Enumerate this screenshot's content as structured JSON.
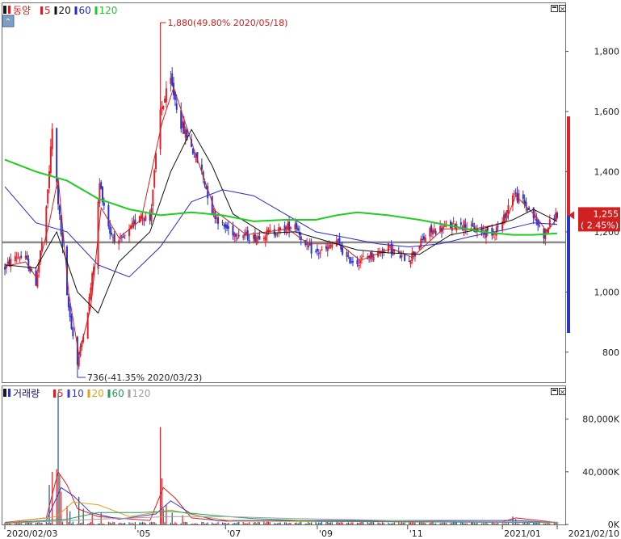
{
  "colors": {
    "up": "#e0202a",
    "down": "#2b34c8",
    "ma5": "#d42020",
    "ma20": "#111111",
    "ma60": "#2a2acc",
    "ma120": "#22cc22",
    "support": "#8a8a8a",
    "vol5": "#e02020",
    "vol10": "#3a3ad8",
    "vol20": "#e0a020",
    "vol60": "#2a9a5a",
    "vol120": "#a0a0a0"
  },
  "price_legend": {
    "name": "동양",
    "items": [
      {
        "label": "5",
        "color": "#d42020"
      },
      {
        "label": "20",
        "color": "#111111"
      },
      {
        "label": "60",
        "color": "#2a2acc"
      },
      {
        "label": "120",
        "color": "#22cc22"
      }
    ]
  },
  "volume_legend": {
    "name": "거래량",
    "items": [
      {
        "label": "5",
        "color": "#e02020"
      },
      {
        "label": "10",
        "color": "#3a3ad8"
      },
      {
        "label": "20",
        "color": "#e0a020"
      },
      {
        "label": "60",
        "color": "#2a9a5a"
      },
      {
        "label": "120",
        "color": "#a0a0a0"
      }
    ]
  },
  "annotations": {
    "high": "1,880(49.80% 2020/05/18)",
    "low": "736(-41.35% 2020/03/23)",
    "last_price": "1,255",
    "last_change": "( 2.45%)"
  },
  "chart_data": [
    {
      "type": "candlestick",
      "title": "동양",
      "ylim": [
        700,
        1960
      ],
      "y_ticks": [
        {
          "value": 800,
          "label": "800"
        },
        {
          "value": 1000,
          "label": "1,000"
        },
        {
          "value": 1200,
          "label": "1,200"
        },
        {
          "value": 1400,
          "label": "1,400"
        },
        {
          "value": 1600,
          "label": "1,600"
        },
        {
          "value": 1800,
          "label": "1,800"
        }
      ],
      "x_ticks": [
        {
          "date": "2020-02-03",
          "label": "2020/02/03"
        },
        {
          "date": "2020-05-01",
          "label": "'05"
        },
        {
          "date": "2020-07-01",
          "label": "'07"
        },
        {
          "date": "2020-09-01",
          "label": "'09"
        },
        {
          "date": "2020-11-01",
          "label": "'11"
        },
        {
          "date": "2021-01-04",
          "label": "2021/01"
        },
        {
          "date": "2021-02-10",
          "label": "2021/02/10"
        }
      ],
      "x_range": [
        "2020-02-03",
        "2021-02-10"
      ],
      "support_level": 1165,
      "high": {
        "value": 1880,
        "date": "2020-05-18"
      },
      "low": {
        "value": 736,
        "date": "2020-03-23"
      },
      "last": {
        "value": 1255,
        "change_pct": 2.45
      },
      "price_path": [
        [
          "2020-02-03",
          1080
        ],
        [
          "2020-02-10",
          1120
        ],
        [
          "2020-02-17",
          1110
        ],
        [
          "2020-02-24",
          1030
        ],
        [
          "2020-03-02",
          1270
        ],
        [
          "2020-03-06",
          1540
        ],
        [
          "2020-03-10",
          1300
        ],
        [
          "2020-03-16",
          980
        ],
        [
          "2020-03-23",
          760
        ],
        [
          "2020-03-30",
          940
        ],
        [
          "2020-04-03",
          1090
        ],
        [
          "2020-04-07",
          1360
        ],
        [
          "2020-04-14",
          1200
        ],
        [
          "2020-04-20",
          1160
        ],
        [
          "2020-04-27",
          1200
        ],
        [
          "2020-05-04",
          1260
        ],
        [
          "2020-05-11",
          1240
        ],
        [
          "2020-05-18",
          1600
        ],
        [
          "2020-05-25",
          1700
        ],
        [
          "2020-06-01",
          1560
        ],
        [
          "2020-06-08",
          1480
        ],
        [
          "2020-06-15",
          1400
        ],
        [
          "2020-06-22",
          1270
        ],
        [
          "2020-06-29",
          1220
        ],
        [
          "2020-07-06",
          1200
        ],
        [
          "2020-07-13",
          1190
        ],
        [
          "2020-07-20",
          1180
        ],
        [
          "2020-07-27",
          1195
        ],
        [
          "2020-08-03",
          1200
        ],
        [
          "2020-08-10",
          1210
        ],
        [
          "2020-08-17",
          1230
        ],
        [
          "2020-08-24",
          1150
        ],
        [
          "2020-08-31",
          1130
        ],
        [
          "2020-09-07",
          1140
        ],
        [
          "2020-09-14",
          1170
        ],
        [
          "2020-09-21",
          1110
        ],
        [
          "2020-09-28",
          1100
        ],
        [
          "2020-10-05",
          1120
        ],
        [
          "2020-10-12",
          1130
        ],
        [
          "2020-10-19",
          1150
        ],
        [
          "2020-10-26",
          1120
        ],
        [
          "2020-11-02",
          1110
        ],
        [
          "2020-11-09",
          1160
        ],
        [
          "2020-11-16",
          1200
        ],
        [
          "2020-11-23",
          1210
        ],
        [
          "2020-11-30",
          1220
        ],
        [
          "2020-12-07",
          1230
        ],
        [
          "2020-12-14",
          1210
        ],
        [
          "2020-12-21",
          1200
        ],
        [
          "2020-12-28",
          1200
        ],
        [
          "2021-01-04",
          1230
        ],
        [
          "2021-01-11",
          1330
        ],
        [
          "2021-01-18",
          1300
        ],
        [
          "2021-01-25",
          1250
        ],
        [
          "2021-02-01",
          1190
        ],
        [
          "2021-02-08",
          1255
        ]
      ],
      "series": [
        {
          "name": "5",
          "values": [
            [
              "2020-02-03",
              1085
            ],
            [
              "2020-02-17",
              1100
            ],
            [
              "2020-02-24",
              1050
            ],
            [
              "2020-03-04",
              1230
            ],
            [
              "2020-03-10",
              1380
            ],
            [
              "2020-03-17",
              1000
            ],
            [
              "2020-03-24",
              790
            ],
            [
              "2020-04-01",
              950
            ],
            [
              "2020-04-08",
              1280
            ],
            [
              "2020-04-20",
              1180
            ],
            [
              "2020-05-05",
              1240
            ],
            [
              "2020-05-19",
              1560
            ],
            [
              "2020-05-27",
              1680
            ],
            [
              "2020-06-10",
              1470
            ],
            [
              "2020-06-24",
              1270
            ],
            [
              "2020-07-15",
              1190
            ],
            [
              "2020-08-12",
              1210
            ],
            [
              "2020-08-26",
              1160
            ],
            [
              "2020-09-16",
              1160
            ],
            [
              "2020-09-30",
              1105
            ],
            [
              "2020-10-21",
              1145
            ],
            [
              "2020-11-04",
              1115
            ],
            [
              "2020-11-25",
              1210
            ],
            [
              "2020-12-16",
              1210
            ],
            [
              "2021-01-06",
              1230
            ],
            [
              "2021-01-13",
              1320
            ],
            [
              "2021-01-27",
              1250
            ],
            [
              "2021-02-03",
              1200
            ],
            [
              "2021-02-10",
              1245
            ]
          ]
        },
        {
          "name": "20",
          "values": [
            [
              "2020-02-03",
              1090
            ],
            [
              "2020-02-24",
              1080
            ],
            [
              "2020-03-09",
              1200
            ],
            [
              "2020-03-23",
              1000
            ],
            [
              "2020-04-06",
              930
            ],
            [
              "2020-04-20",
              1100
            ],
            [
              "2020-05-11",
              1200
            ],
            [
              "2020-05-25",
              1400
            ],
            [
              "2020-06-08",
              1540
            ],
            [
              "2020-06-22",
              1420
            ],
            [
              "2020-07-06",
              1260
            ],
            [
              "2020-07-27",
              1195
            ],
            [
              "2020-08-17",
              1200
            ],
            [
              "2020-09-07",
              1170
            ],
            [
              "2020-09-28",
              1140
            ],
            [
              "2020-10-19",
              1130
            ],
            [
              "2020-11-09",
              1125
            ],
            [
              "2020-11-30",
              1190
            ],
            [
              "2020-12-21",
              1210
            ],
            [
              "2021-01-11",
              1240
            ],
            [
              "2021-01-25",
              1275
            ],
            [
              "2021-02-10",
              1235
            ]
          ]
        },
        {
          "name": "60",
          "values": [
            [
              "2020-02-03",
              1350
            ],
            [
              "2020-02-24",
              1230
            ],
            [
              "2020-03-16",
              1200
            ],
            [
              "2020-04-06",
              1090
            ],
            [
              "2020-04-27",
              1050
            ],
            [
              "2020-05-18",
              1150
            ],
            [
              "2020-06-08",
              1300
            ],
            [
              "2020-06-29",
              1340
            ],
            [
              "2020-07-20",
              1320
            ],
            [
              "2020-08-10",
              1260
            ],
            [
              "2020-08-31",
              1200
            ],
            [
              "2020-09-21",
              1180
            ],
            [
              "2020-10-12",
              1160
            ],
            [
              "2020-11-02",
              1150
            ],
            [
              "2020-11-23",
              1160
            ],
            [
              "2020-12-14",
              1185
            ],
            [
              "2021-01-04",
              1205
            ],
            [
              "2021-01-25",
              1230
            ],
            [
              "2021-02-10",
              1225
            ]
          ]
        },
        {
          "name": "120",
          "values": [
            [
              "2020-02-03",
              1440
            ],
            [
              "2020-02-24",
              1400
            ],
            [
              "2020-03-16",
              1370
            ],
            [
              "2020-04-06",
              1310
            ],
            [
              "2020-04-27",
              1275
            ],
            [
              "2020-05-18",
              1255
            ],
            [
              "2020-06-08",
              1265
            ],
            [
              "2020-06-29",
              1255
            ],
            [
              "2020-07-20",
              1235
            ],
            [
              "2020-08-10",
              1240
            ],
            [
              "2020-08-31",
              1240
            ],
            [
              "2020-09-14",
              1255
            ],
            [
              "2020-09-28",
              1265
            ],
            [
              "2020-10-19",
              1255
            ],
            [
              "2020-11-09",
              1240
            ],
            [
              "2020-11-30",
              1220
            ],
            [
              "2020-12-21",
              1200
            ],
            [
              "2021-01-11",
              1190
            ],
            [
              "2021-01-25",
              1190
            ],
            [
              "2021-02-10",
              1195
            ]
          ]
        }
      ]
    },
    {
      "type": "bar",
      "title": "거래량",
      "ylim": [
        0,
        105000
      ],
      "y_ticks": [
        {
          "value": 0,
          "label": "0K"
        },
        {
          "value": 40000,
          "label": "40,000K"
        },
        {
          "value": 80000,
          "label": "80,000K"
        }
      ],
      "spikes": [
        [
          "2020-03-04",
          30000
        ],
        [
          "2020-03-06",
          40000
        ],
        [
          "2020-03-09",
          42000
        ],
        [
          "2020-03-10",
          100000
        ],
        [
          "2020-03-11",
          38000
        ],
        [
          "2020-03-12",
          25000
        ],
        [
          "2020-03-16",
          14000
        ],
        [
          "2020-03-18",
          10000
        ],
        [
          "2020-03-24",
          21000
        ],
        [
          "2020-03-27",
          12000
        ],
        [
          "2020-04-02",
          8000
        ],
        [
          "2020-04-08",
          9000
        ],
        [
          "2020-05-18",
          74000
        ],
        [
          "2020-05-19",
          35000
        ],
        [
          "2020-05-20",
          12000
        ],
        [
          "2020-05-22",
          15000
        ],
        [
          "2020-05-26",
          9000
        ],
        [
          "2020-06-02",
          7000
        ],
        [
          "2021-01-11",
          6000
        ],
        [
          "2021-01-13",
          4000
        ]
      ],
      "series": [
        {
          "name": "5",
          "values": [
            [
              "2020-02-03",
              1500
            ],
            [
              "2020-03-02",
              5000
            ],
            [
              "2020-03-10",
              40000
            ],
            [
              "2020-03-16",
              30000
            ],
            [
              "2020-03-23",
              12000
            ],
            [
              "2020-04-06",
              6000
            ],
            [
              "2020-05-11",
              3000
            ],
            [
              "2020-05-20",
              28000
            ],
            [
              "2020-05-28",
              20000
            ],
            [
              "2020-06-08",
              5000
            ],
            [
              "2020-07-01",
              2500
            ],
            [
              "2021-01-04",
              2000
            ],
            [
              "2021-01-13",
              5000
            ],
            [
              "2021-02-10",
              1500
            ]
          ]
        },
        {
          "name": "10",
          "values": [
            [
              "2020-02-03",
              1200
            ],
            [
              "2020-03-02",
              3000
            ],
            [
              "2020-03-12",
              28000
            ],
            [
              "2020-03-20",
              22000
            ],
            [
              "2020-04-01",
              9000
            ],
            [
              "2020-04-20",
              4000
            ],
            [
              "2020-05-15",
              8000
            ],
            [
              "2020-05-25",
              18000
            ],
            [
              "2020-06-08",
              8000
            ],
            [
              "2020-06-25",
              3000
            ],
            [
              "2021-01-13",
              3000
            ],
            [
              "2021-02-10",
              1500
            ]
          ]
        },
        {
          "name": "20",
          "values": [
            [
              "2020-02-03",
              1000
            ],
            [
              "2020-03-09",
              6000
            ],
            [
              "2020-03-20",
              17000
            ],
            [
              "2020-04-06",
              15000
            ],
            [
              "2020-04-27",
              6000
            ],
            [
              "2020-05-25",
              11000
            ],
            [
              "2020-06-15",
              6000
            ],
            [
              "2020-07-06",
              2500
            ],
            [
              "2021-02-10",
              1500
            ]
          ]
        },
        {
          "name": "60",
          "values": [
            [
              "2020-02-03",
              900
            ],
            [
              "2020-03-16",
              4000
            ],
            [
              "2020-04-06",
              9000
            ],
            [
              "2020-05-04",
              9000
            ],
            [
              "2020-05-25",
              10000
            ],
            [
              "2020-06-22",
              7000
            ],
            [
              "2020-07-20",
              4500
            ],
            [
              "2020-09-01",
              2500
            ],
            [
              "2020-11-02",
              2000
            ],
            [
              "2021-02-10",
              1500
            ]
          ]
        },
        {
          "name": "120",
          "values": [
            [
              "2020-02-03",
              800
            ],
            [
              "2020-04-06",
              4000
            ],
            [
              "2020-05-25",
              6000
            ],
            [
              "2020-07-01",
              6000
            ],
            [
              "2020-08-17",
              4500
            ],
            [
              "2020-10-01",
              3500
            ],
            [
              "2020-11-16",
              2500
            ],
            [
              "2021-01-01",
              2000
            ],
            [
              "2021-02-10",
              1800
            ]
          ]
        }
      ]
    }
  ]
}
